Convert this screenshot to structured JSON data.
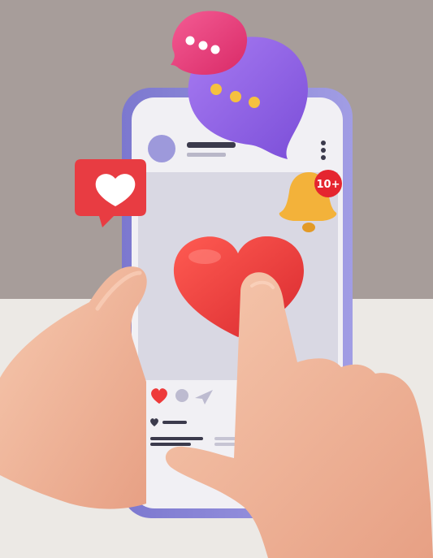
{
  "notification": {
    "badge_count": "10+"
  },
  "colors": {
    "wall": "#a79d9a",
    "floor": "#ece9e5",
    "phone_frame": "#8a86d6",
    "screen": "#f1f0f4",
    "heart_red": "#ee3a3a",
    "chat_pink": "#ec3d7b",
    "chat_purple": "#8f5ee8",
    "bell_gold": "#f3b23a",
    "skin": "#f1b69a"
  },
  "icons": [
    "heart-icon",
    "chat-bubble-icon",
    "bell-icon",
    "share-icon",
    "more-icon"
  ]
}
